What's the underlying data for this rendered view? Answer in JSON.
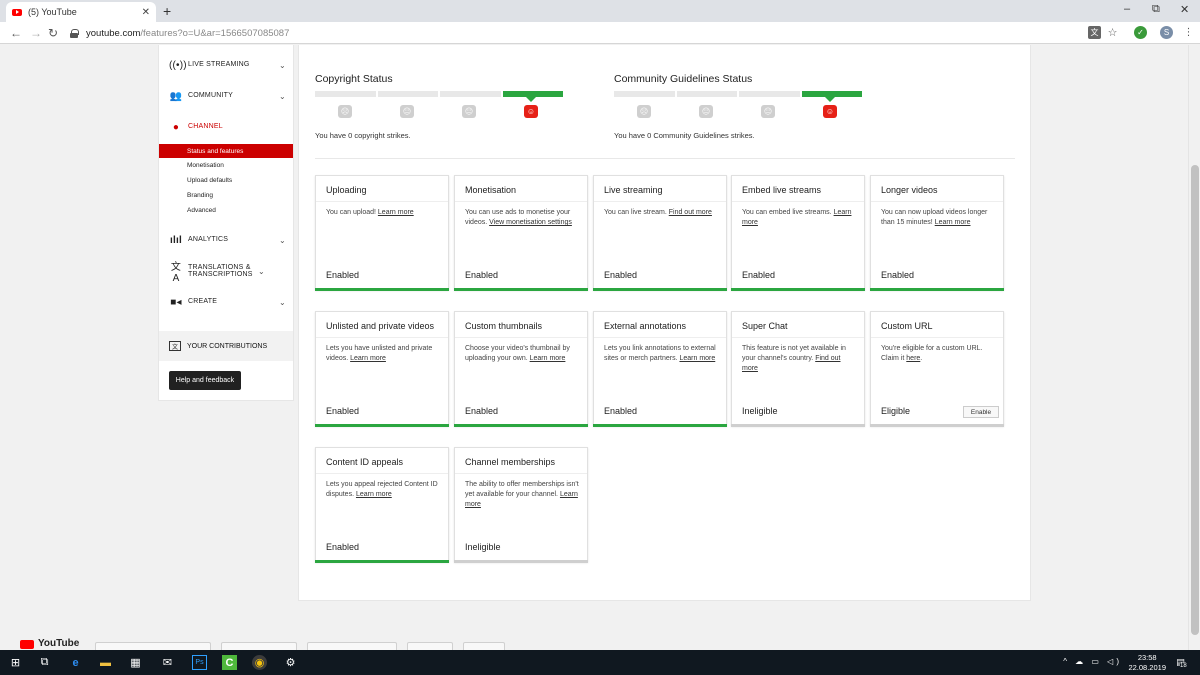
{
  "browser": {
    "tab_title": "(5) YouTube",
    "tab_close": "✕",
    "new_tab": "+",
    "url_host": "youtube.com",
    "url_path": "/features?o=U&ar=1566507085087",
    "win_min": "–",
    "win_max": "⧉",
    "win_close": "✕",
    "profile_initial": "S"
  },
  "sidebar": {
    "live_streaming": "LIVE STREAMING",
    "community": "COMMUNITY",
    "channel": "CHANNEL",
    "sub_items": [
      "Status and features",
      "Monetisation",
      "Upload defaults",
      "Branding",
      "Advanced"
    ],
    "analytics": "ANALYTICS",
    "translations": "TRANSLATIONS & TRANSCRIPTIONS",
    "create": "CREATE",
    "contributions": "YOUR CONTRIBUTIONS",
    "help": "Help and feedback"
  },
  "copyright": {
    "title": "Copyright Status",
    "text": "You have 0 copyright strikes."
  },
  "community_status": {
    "title": "Community Guidelines Status",
    "text": "You have 0 Community Guidelines strikes."
  },
  "tiles": [
    {
      "title": "Uploading",
      "desc": "You can upload! ",
      "link": "Learn more",
      "status": "Enabled"
    },
    {
      "title": "Monetisation",
      "desc": "You can use ads to monetise your videos. ",
      "link": "View monetisation settings",
      "status": "Enabled"
    },
    {
      "title": "Live streaming",
      "desc": "You can live stream. ",
      "link": "Find out more",
      "status": "Enabled"
    },
    {
      "title": "Embed live streams",
      "desc": "You can embed live streams. ",
      "link": "Learn more",
      "status": "Enabled"
    },
    {
      "title": "Longer videos",
      "desc": "You can now upload videos longer than 15 minutes! ",
      "link": "Learn more",
      "status": "Enabled"
    },
    {
      "title": "Unlisted and private videos",
      "desc": "Lets you have unlisted and private videos. ",
      "link": "Learn more",
      "status": "Enabled"
    },
    {
      "title": "Custom thumbnails",
      "desc": "Choose your video's thumbnail by uploading your own. ",
      "link": "Learn more",
      "status": "Enabled"
    },
    {
      "title": "External annotations",
      "desc": "Lets you link annotations to external sites or merch partners. ",
      "link": "Learn more",
      "status": "Enabled"
    },
    {
      "title": "Super Chat",
      "desc": "This feature is not yet available in your channel's country. ",
      "link": "Find out more",
      "status": "Ineligible"
    },
    {
      "title": "Custom URL",
      "desc": "You're eligible for a custom URL. Claim it ",
      "link": "here",
      "status": "Eligible",
      "button": "Enable"
    },
    {
      "title": "Content ID appeals",
      "desc": "Lets you appeal rejected Content ID disputes. ",
      "link": "Learn more",
      "status": "Enabled"
    },
    {
      "title": "Channel memberships",
      "desc": "The ability to offer memberships isn't yet available for your channel. ",
      "link": "Learn more",
      "status": "Ineligible"
    }
  ],
  "footer": {
    "logo_text": "YouTube"
  },
  "taskbar": {
    "time": "23:58",
    "date": "22.08.2019",
    "notification_count": "18"
  },
  "colors": {
    "enabled": "#2ba640",
    "ineligible": "#cfcfcf",
    "selected_nav": "#cc0000"
  }
}
